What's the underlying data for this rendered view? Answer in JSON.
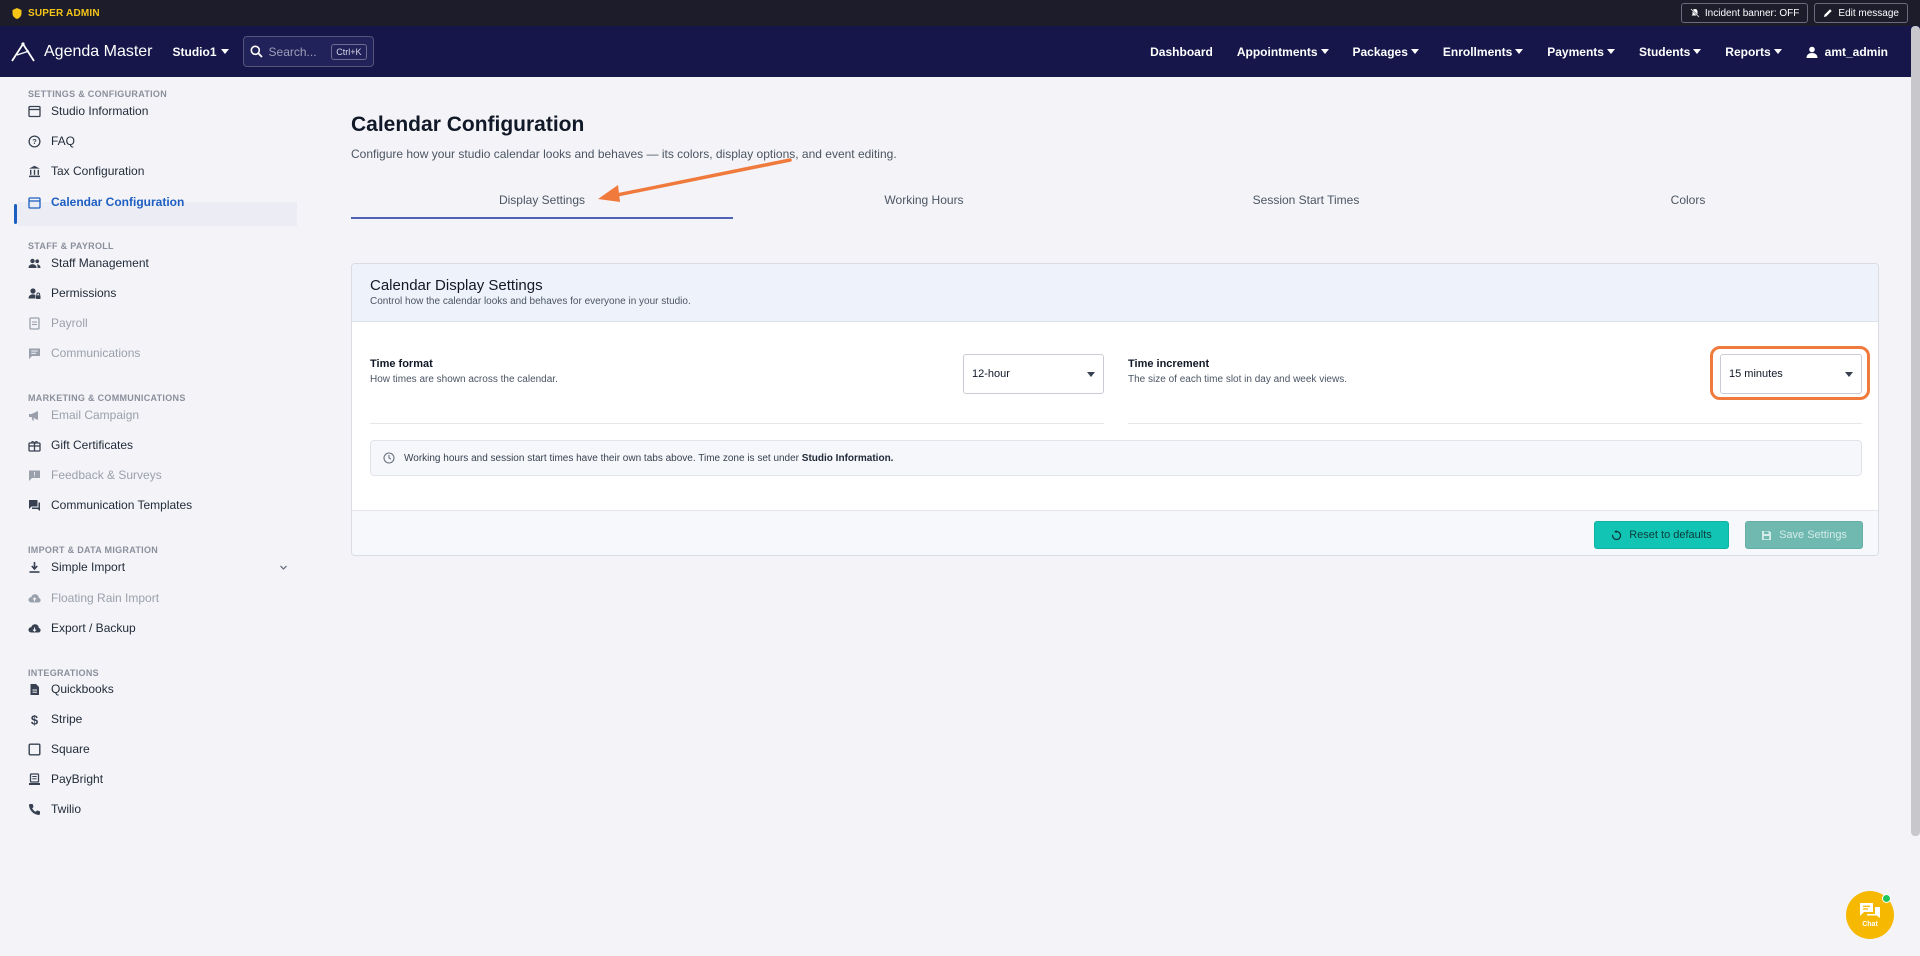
{
  "admin_bar": {
    "badge": "SUPER ADMIN",
    "incident_banner": "Incident banner: OFF",
    "edit_message": "Edit message"
  },
  "navbar": {
    "brand": "Agenda Master",
    "studio": "Studio1",
    "search_placeholder": "Search...",
    "search_shortcut": "Ctrl+K",
    "links": [
      "Dashboard",
      "Appointments",
      "Packages",
      "Enrollments",
      "Payments",
      "Students",
      "Reports"
    ],
    "user": "amt_admin"
  },
  "sidebar": {
    "sections": [
      {
        "title": "SETTINGS & CONFIGURATION"
      },
      {
        "title": "STAFF & PAYROLL"
      },
      {
        "title": "MARKETING & COMMUNICATIONS"
      },
      {
        "title": "IMPORT & DATA MIGRATION"
      },
      {
        "title": "INTEGRATIONS"
      }
    ],
    "items": [
      {
        "label": "Studio Information"
      },
      {
        "label": "FAQ"
      },
      {
        "label": "Tax Configuration"
      },
      {
        "label": "Calendar Configuration"
      },
      {
        "label": "Staff Management"
      },
      {
        "label": "Permissions"
      },
      {
        "label": "Payroll"
      },
      {
        "label": "Communications"
      },
      {
        "label": "Email Campaign"
      },
      {
        "label": "Gift Certificates"
      },
      {
        "label": "Feedback & Surveys"
      },
      {
        "label": "Communication Templates"
      },
      {
        "label": "Simple Import"
      },
      {
        "label": "Floating Rain Import"
      },
      {
        "label": "Export / Backup"
      },
      {
        "label": "Quickbooks"
      },
      {
        "label": "Stripe"
      },
      {
        "label": "Square"
      },
      {
        "label": "PayBright"
      },
      {
        "label": "Twilio"
      }
    ]
  },
  "page": {
    "title": "Calendar Configuration",
    "subtitle": "Configure how your studio calendar looks and behaves — its colors, display options, and event editing."
  },
  "tabs": [
    "Display Settings",
    "Working Hours",
    "Session Start Times",
    "Colors"
  ],
  "card": {
    "title": "Calendar Display Settings",
    "description": "Control how the calendar looks and behaves for everyone in your studio.",
    "time_format": {
      "label": "Time format",
      "help": "How times are shown across the calendar.",
      "value": "12-hour"
    },
    "time_increment": {
      "label": "Time increment",
      "help": "The size of each time slot in day and week views.",
      "value": "15 minutes"
    },
    "info_text": "Working hours and session start times have their own tabs above. Time zone is set under",
    "info_link": "Studio Information.",
    "reset_label": "Reset to defaults",
    "save_label": "Save Settings"
  },
  "chat": {
    "label": "Chat"
  },
  "colors": {
    "navbar": "#16164a",
    "accent": "#1d5fc1",
    "reset_button": "#12c4b4",
    "highlight": "#f07a3c",
    "chat": "#f6b800"
  }
}
